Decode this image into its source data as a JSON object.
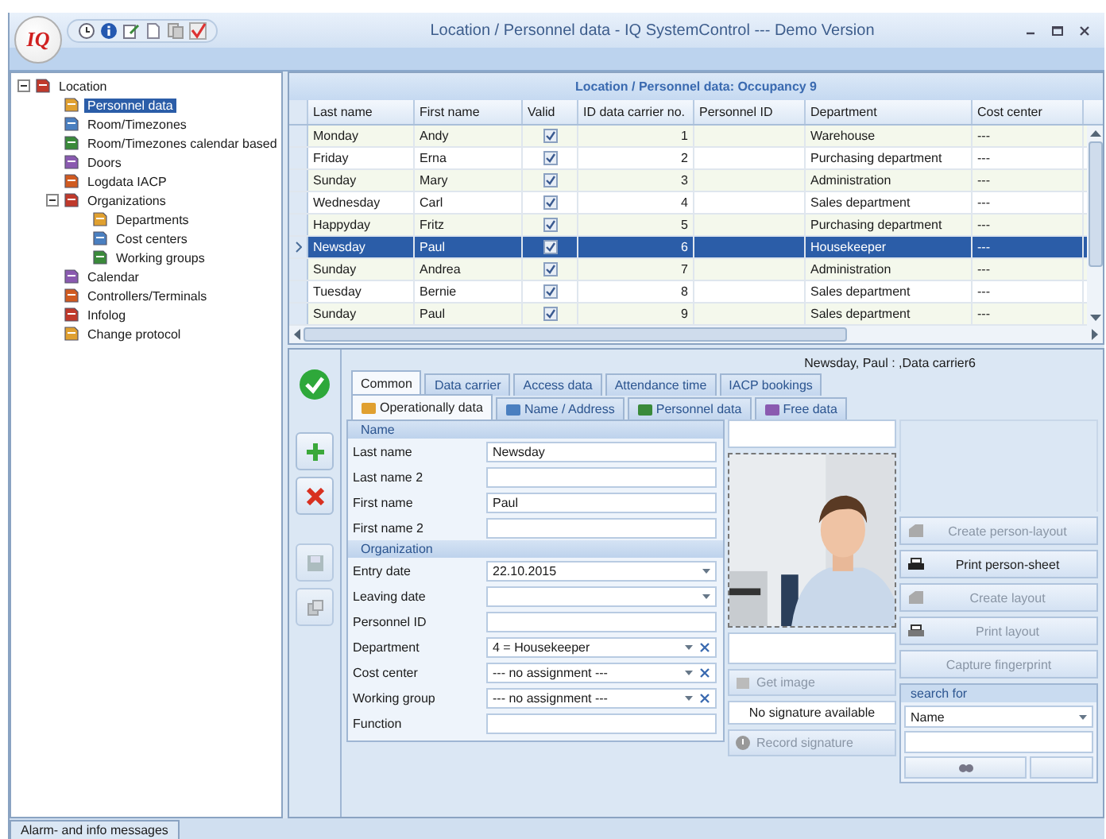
{
  "window": {
    "logo": "IQ",
    "title": "Location / Personnel data - IQ SystemControl --- Demo Version"
  },
  "tree": [
    {
      "label": "Location",
      "expanded": true,
      "selected": false,
      "children": [
        {
          "label": "Personnel data",
          "selected": true
        },
        {
          "label": "Room/Timezones",
          "selected": false
        },
        {
          "label": "Room/Timezones calendar based",
          "selected": false
        },
        {
          "label": "Doors",
          "selected": false
        },
        {
          "label": "Logdata IACP",
          "selected": false
        },
        {
          "label": "Organizations",
          "expanded": true,
          "selected": false,
          "children": [
            {
              "label": "Departments",
              "selected": false
            },
            {
              "label": "Cost centers",
              "selected": false
            },
            {
              "label": "Working groups",
              "selected": false
            }
          ]
        },
        {
          "label": "Calendar",
          "selected": false
        },
        {
          "label": "Controllers/Terminals",
          "selected": false
        },
        {
          "label": "Infolog",
          "selected": false
        },
        {
          "label": "Change protocol",
          "selected": false
        }
      ]
    }
  ],
  "grid": {
    "title": "Location / Personnel data: Occupancy 9",
    "columns": [
      "Last name",
      "First name",
      "Valid",
      "ID data carrier no.",
      "Personnel ID",
      "Department",
      "Cost center"
    ],
    "rows": [
      {
        "last_name": "Monday",
        "first_name": "Andy",
        "valid": true,
        "carrier_no": "1",
        "department": "Warehouse",
        "cost_center": "---",
        "selected": false
      },
      {
        "last_name": "Friday",
        "first_name": "Erna",
        "valid": true,
        "carrier_no": "2",
        "department": "Purchasing department",
        "cost_center": "---",
        "selected": false
      },
      {
        "last_name": "Sunday",
        "first_name": "Mary",
        "valid": true,
        "carrier_no": "3",
        "department": "Administration",
        "cost_center": "---",
        "selected": false
      },
      {
        "last_name": "Wednesday",
        "first_name": "Carl",
        "valid": true,
        "carrier_no": "4",
        "department": "Sales department",
        "cost_center": "---",
        "selected": false
      },
      {
        "last_name": "Happyday",
        "first_name": "Fritz",
        "valid": true,
        "carrier_no": "5",
        "department": "Purchasing department",
        "cost_center": "---",
        "selected": false
      },
      {
        "last_name": "Newsday",
        "first_name": "Paul",
        "valid": true,
        "carrier_no": "6",
        "department": "Housekeeper",
        "cost_center": "---",
        "selected": true
      },
      {
        "last_name": "Sunday",
        "first_name": "Andrea",
        "valid": true,
        "carrier_no": "7",
        "department": "Administration",
        "cost_center": "---",
        "selected": false
      },
      {
        "last_name": "Tuesday",
        "first_name": "Bernie",
        "valid": true,
        "carrier_no": "8",
        "department": "Sales department",
        "cost_center": "---",
        "selected": false
      },
      {
        "last_name": "Sunday",
        "first_name": "Paul",
        "valid": true,
        "carrier_no": "9",
        "department": "Sales department",
        "cost_center": "---",
        "selected": false
      }
    ]
  },
  "toolbar": [
    {
      "kind": "confirm",
      "disabled": false
    },
    {
      "kind": "add",
      "disabled": false
    },
    {
      "kind": "delete",
      "disabled": false
    },
    {
      "kind": "save",
      "disabled": true
    },
    {
      "kind": "copy",
      "disabled": true
    }
  ],
  "detail": {
    "caption": "Newsday, Paul : ,Data carrier6",
    "tabs": [
      {
        "label": "Common",
        "selected": true
      },
      {
        "label": "Data carrier",
        "selected": false
      },
      {
        "label": "Access data",
        "selected": false
      },
      {
        "label": "Attendance time",
        "selected": false
      },
      {
        "label": "IACP bookings",
        "selected": false
      }
    ],
    "subtabs": [
      {
        "label": "Operationally data",
        "selected": true
      },
      {
        "label": "Name / Address",
        "selected": false
      },
      {
        "label": "Personnel data",
        "selected": false
      },
      {
        "label": "Free data",
        "selected": false
      }
    ],
    "sections": [
      {
        "title": "Name",
        "fields": [
          {
            "label": "Last name",
            "kind": "text",
            "value": "Newsday"
          },
          {
            "label": "Last name 2",
            "kind": "text"
          },
          {
            "label": "First name",
            "kind": "text",
            "value": "Paul"
          },
          {
            "label": "First name 2",
            "kind": "text"
          }
        ]
      },
      {
        "title": "Organization",
        "fields": [
          {
            "label": "Entry date",
            "kind": "date",
            "value": "22.10.2015"
          },
          {
            "label": "Leaving date",
            "kind": "date"
          },
          {
            "label": "Personnel ID",
            "kind": "text"
          },
          {
            "label": "Department",
            "kind": "combo",
            "value": "4 = Housekeeper"
          },
          {
            "label": "Cost center",
            "kind": "combo",
            "value": "--- no assignment ---"
          },
          {
            "label": "Working group",
            "kind": "combo",
            "value": "--- no assignment ---"
          },
          {
            "label": "Function",
            "kind": "text"
          }
        ]
      }
    ],
    "photo": {
      "get_image": {
        "label": "Get image",
        "disabled": true
      },
      "signature_status": "No signature available",
      "record_signature": {
        "label": "Record signature",
        "disabled": true
      }
    },
    "actions": [
      {
        "label": "Create person-layout",
        "kind": "layout",
        "disabled": true
      },
      {
        "label": "Print person-sheet",
        "kind": "print",
        "disabled": false
      },
      {
        "label": "Create layout",
        "kind": "layout",
        "disabled": true
      },
      {
        "label": "Print layout",
        "kind": "print",
        "disabled": true
      },
      {
        "label": "Capture fingerprint",
        "kind": "text",
        "disabled": true
      }
    ],
    "search": {
      "title": "search for",
      "field": "Name"
    }
  },
  "status_tab": "Alarm- and info messages"
}
